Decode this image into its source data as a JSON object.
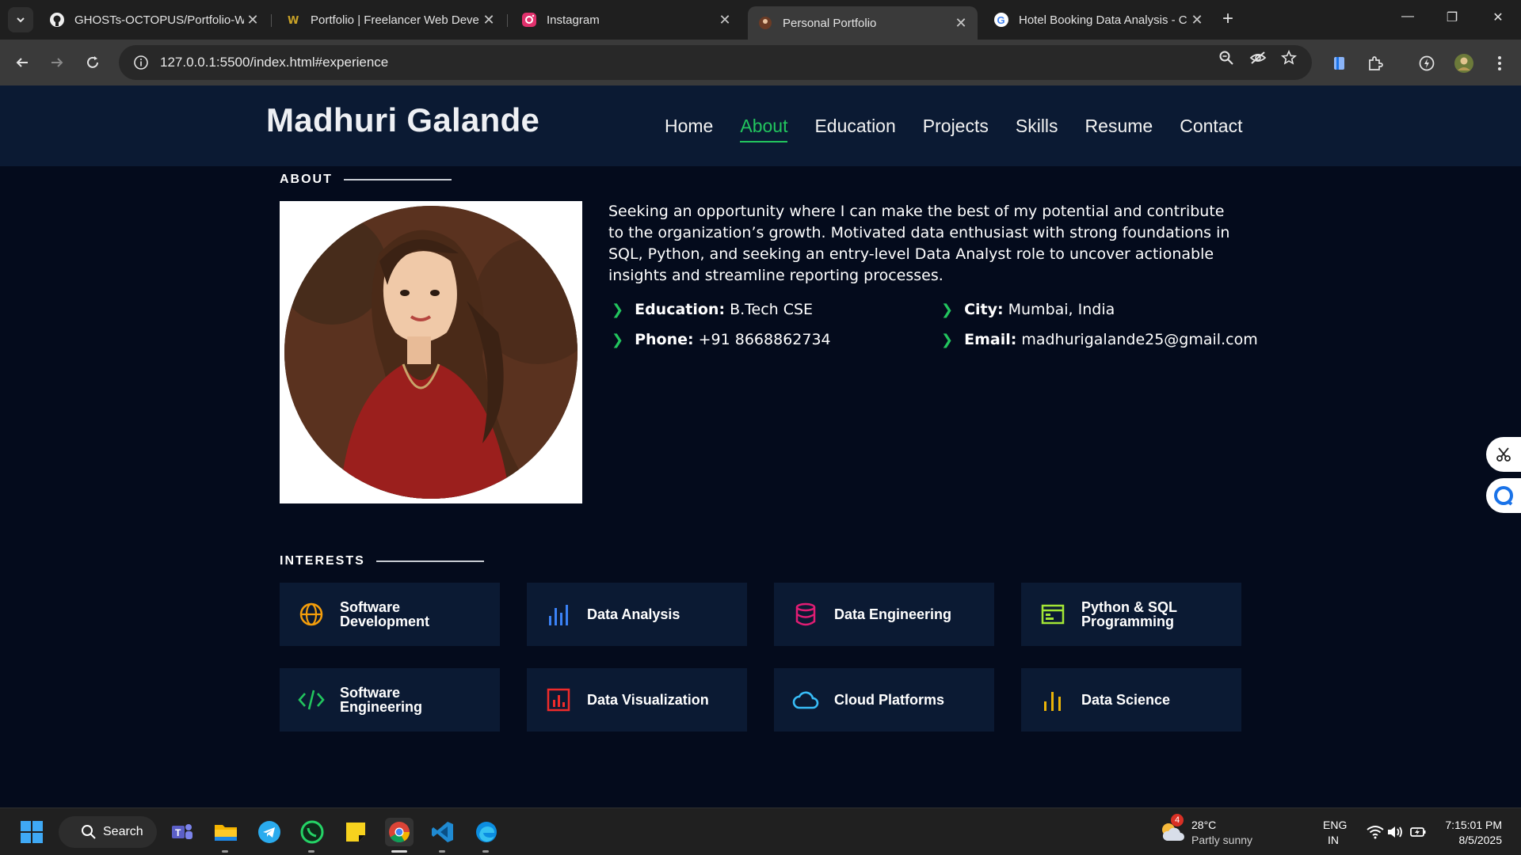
{
  "browser": {
    "tabs": [
      {
        "title": "GHOSTs-OCTOPUS/Portfolio-W",
        "icon": "github-icon"
      },
      {
        "title": "Portfolio | Freelancer Web Deve",
        "icon": "freelancer-icon"
      },
      {
        "title": "Instagram",
        "icon": "instagram-icon"
      },
      {
        "title": "Personal Portfolio",
        "icon": "portfolio-favicon",
        "active": true
      },
      {
        "title": "Hotel Booking Data Analysis - C",
        "icon": "google-icon"
      }
    ],
    "url": "127.0.0.1:5500/index.html#experience"
  },
  "site": {
    "logo": "Madhuri Galande",
    "nav": [
      "Home",
      "About",
      "Education",
      "Projects",
      "Skills",
      "Resume",
      "Contact"
    ],
    "active_nav": "About"
  },
  "about": {
    "heading": "ABOUT",
    "text": "Seeking an opportunity where I can make the best of my potential and contribute to the organization’s growth. Motivated data enthusiast with strong foundations in SQL, Python, and seeking an entry-level Data Analyst role to uncover actionable insights and streamline reporting processes.",
    "facts": [
      {
        "label": "Education:",
        "value": "B.Tech CSE"
      },
      {
        "label": "City:",
        "value": "Mumbai, India"
      },
      {
        "label": "Phone:",
        "value": "+91 8668862734"
      },
      {
        "label": "Email:",
        "value": "madhurigalande25@gmail.com"
      }
    ]
  },
  "interests": {
    "heading": "INTERESTS",
    "items": [
      {
        "label": "Software Development",
        "icon": "globe-icon",
        "color": "#f59e0b"
      },
      {
        "label": "Data Analysis",
        "icon": "bar-chart-icon",
        "color": "#3b82f6"
      },
      {
        "label": "Data Engineering",
        "icon": "database-icon",
        "color": "#e11d74"
      },
      {
        "label": "Python & SQL Programming",
        "icon": "window-code-icon",
        "color": "#a3e635"
      },
      {
        "label": "Software Engineering",
        "icon": "code-icon",
        "color": "#22c55e"
      },
      {
        "label": "Data Visualization",
        "icon": "chart-box-icon",
        "color": "#ef2b2b"
      },
      {
        "label": "Cloud Platforms",
        "icon": "cloud-icon",
        "color": "#38bdf8"
      },
      {
        "label": "Data Science",
        "icon": "bars-icon",
        "color": "#eab308"
      }
    ]
  },
  "taskbar": {
    "search": "Search",
    "weather_temp": "28°C",
    "weather_desc": "Partly sunny",
    "weather_badge": "4",
    "lang1": "ENG",
    "lang2": "IN",
    "time": "7:15:01 PM",
    "date": "8/5/2025"
  }
}
